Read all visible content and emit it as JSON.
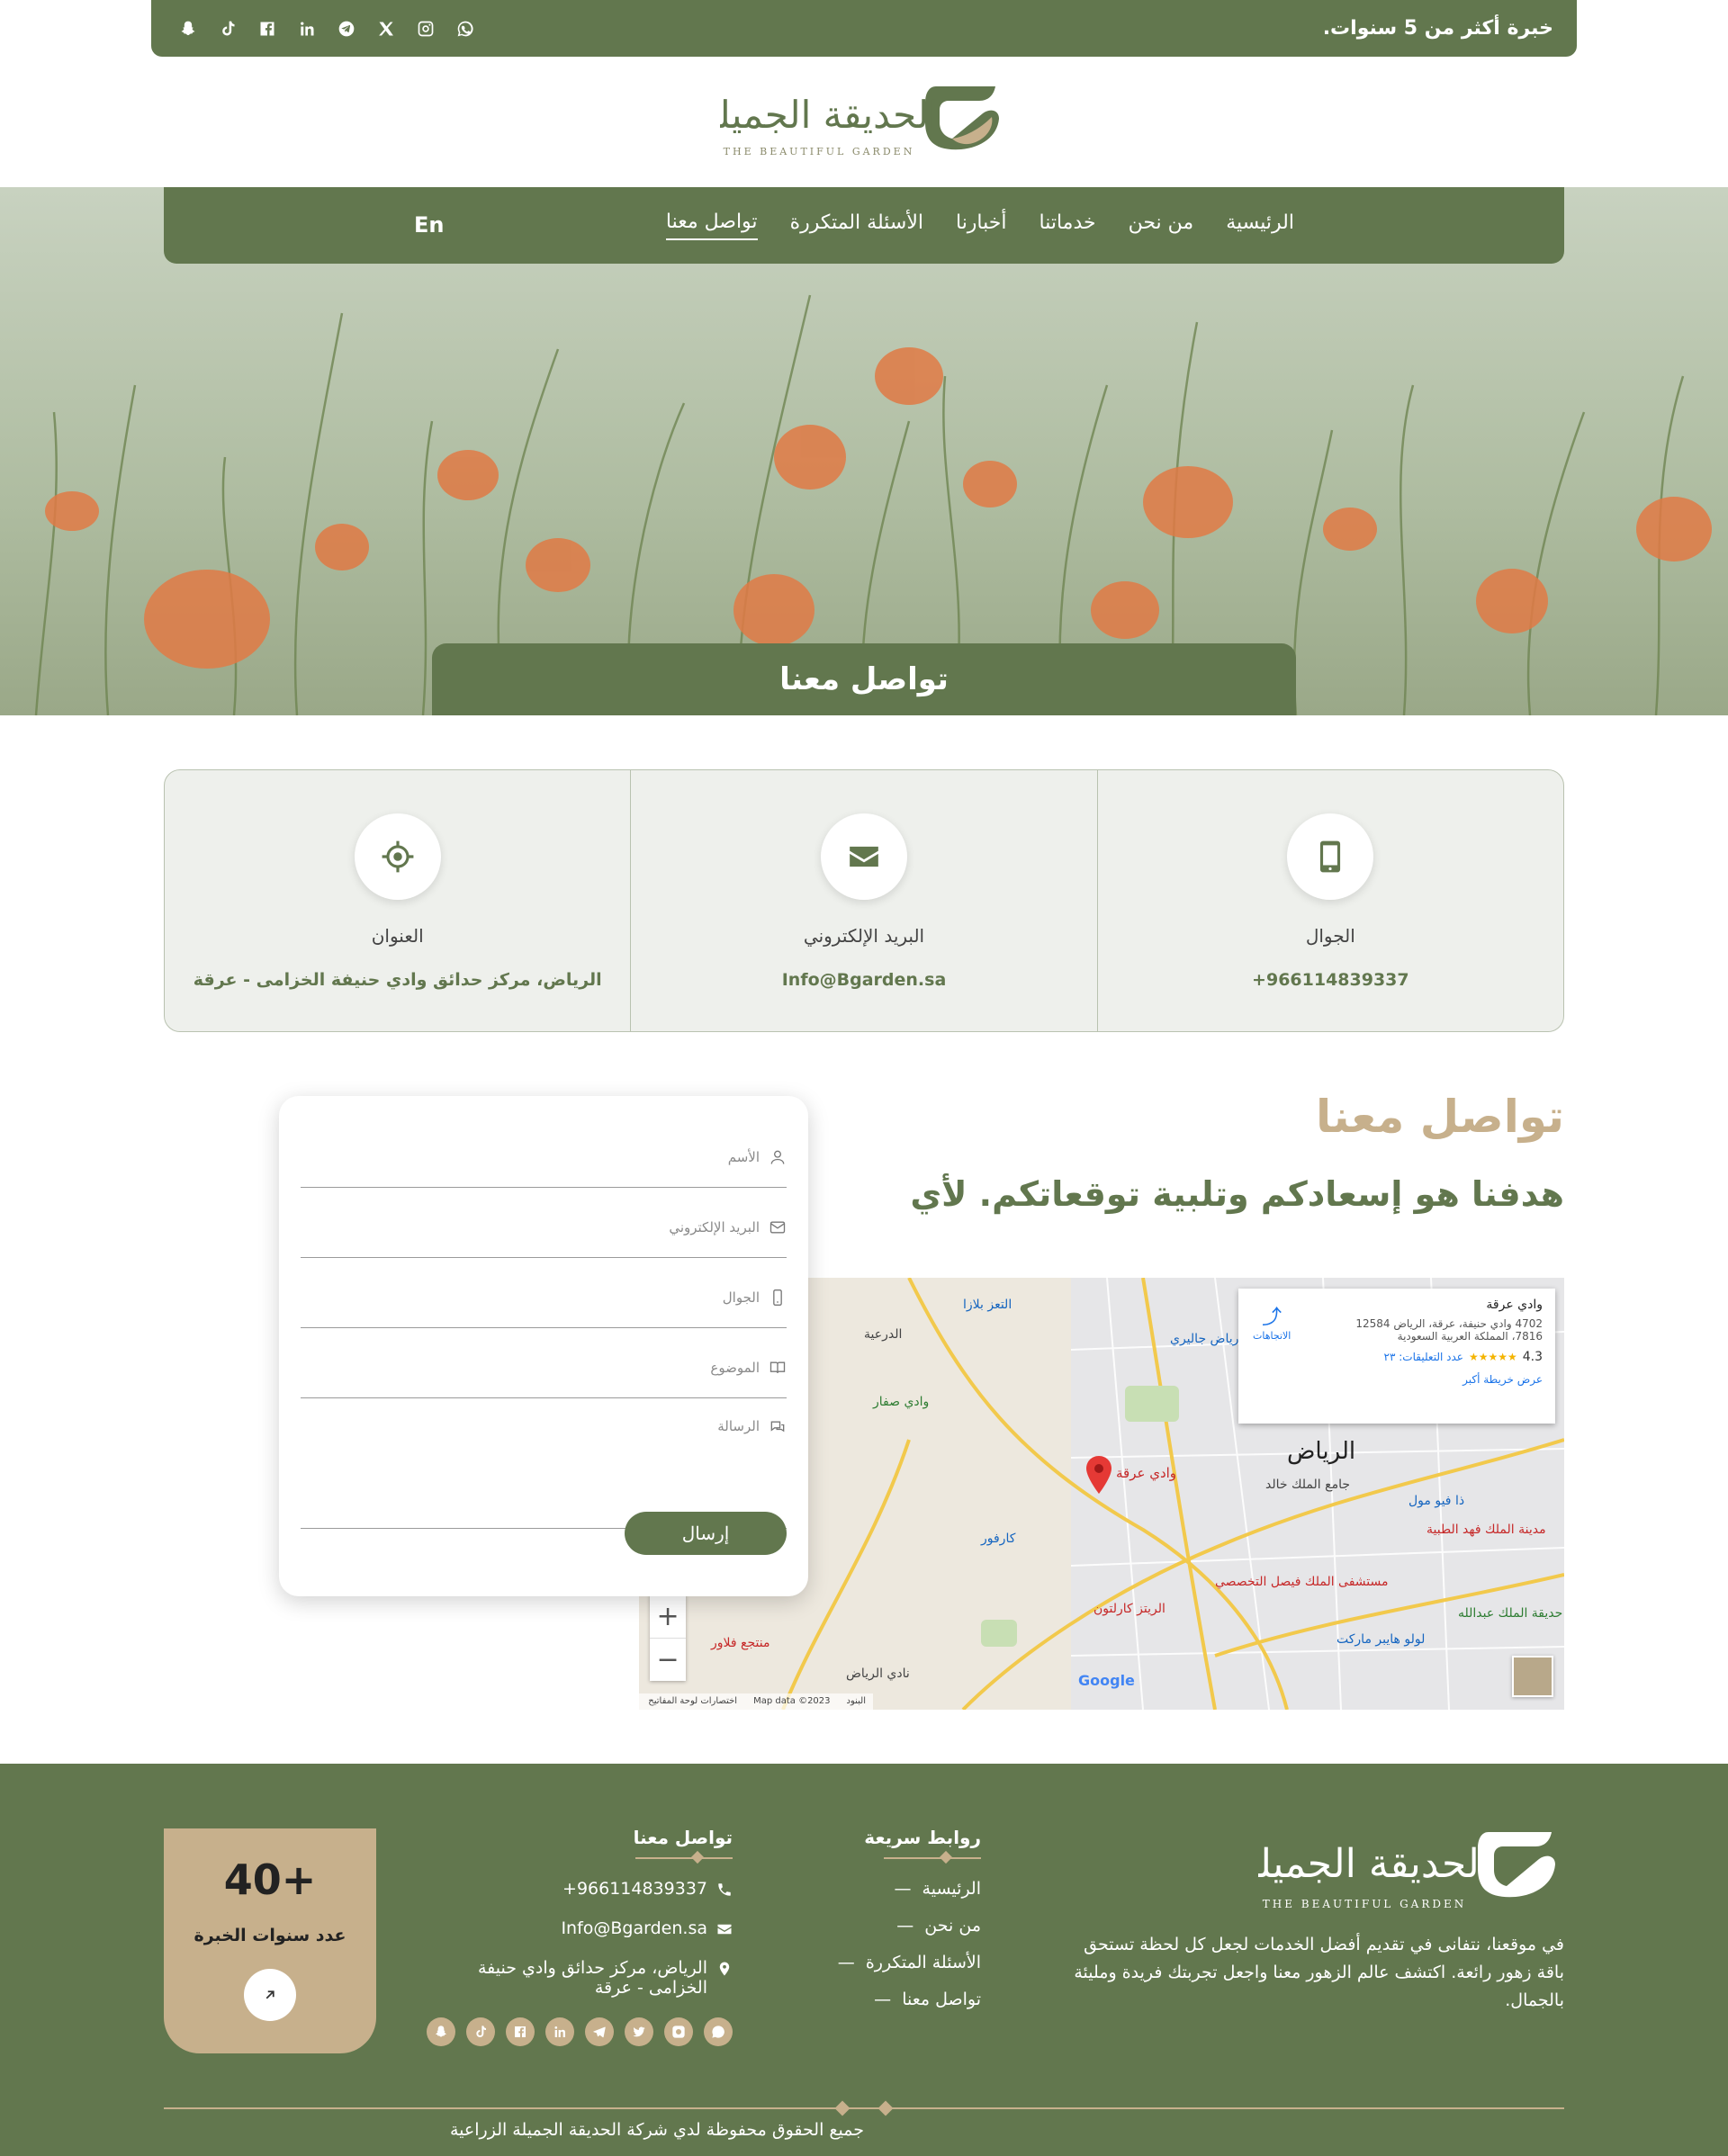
{
  "topbar": {
    "experience": "خبرة أكثر من 5 سنوات.",
    "socials": [
      "snapchat-icon",
      "tiktok-icon",
      "facebook-icon",
      "linkedin-icon",
      "telegram-icon",
      "x-icon",
      "instagram-icon",
      "whatsapp-icon"
    ]
  },
  "logo": {
    "ar": "الحديقة الجميلة",
    "en": "THE BEAUTIFUL GARDEN"
  },
  "nav": {
    "items": [
      {
        "label": "الرئيسية"
      },
      {
        "label": "من نحن"
      },
      {
        "label": "خدماتنا"
      },
      {
        "label": "أخبارنا"
      },
      {
        "label": "الأسئلة المتكررة"
      },
      {
        "label": "تواصل معنا",
        "active": true
      }
    ],
    "lang": "En"
  },
  "hero": {
    "title": "تواصل معنا"
  },
  "info_cards": [
    {
      "icon": "mobile-icon",
      "title": "الجوال",
      "value": "966114839337+"
    },
    {
      "icon": "envelope-icon",
      "title": "البريد الإلكتروني",
      "value": "Info@Bgarden.sa"
    },
    {
      "icon": "location-crosshair-icon",
      "title": "العنوان",
      "value": "الرياض، مركز حدائق وادي حنيفة الخزامى - عرقة"
    }
  ],
  "contact": {
    "title": "تواصل معنا",
    "subtitle": "هدفنا هو إسعادكم وتلبية توقعاتكم. لأي"
  },
  "form": {
    "name_placeholder": "الأسم",
    "email_placeholder": "البريد الإلكتروني",
    "phone_placeholder": "الجوال",
    "subject_placeholder": "الموضوع",
    "message_placeholder": "الرسالة",
    "submit": "إرسال"
  },
  "map": {
    "place_name": "وادي عرقة",
    "address_line1": "4702 وادي حنيفة، عرقة، الرياض 12584",
    "address_line2": "7816، المملكة العربية السعودية",
    "rating": "4.3",
    "reviews": "عدد التعليقات: ٢٣",
    "larger_map": "عرض خريطة أكبر",
    "directions": "الاتجاهات",
    "city_label": "الرياض",
    "marker_label": "وادي عرقة",
    "labels": [
      "الدرعية",
      "وادي صفار",
      "كارفور",
      "التعز بلازا",
      "رياض جاليري",
      "جامع الملك خالد",
      "مستشفى الملك فيصل التخصصي",
      "الريتز كارلتون",
      "منتجع فلاور",
      "نادي الرياض",
      "لولو هايبر ماركت",
      "ذا فيو مول",
      "مدينة الملك فهد الطبية",
      "حديقة الملك عبدالله"
    ],
    "attribution": "Map data ©2023",
    "shortcuts": "اختصارات لوحة المفاتيح",
    "terms": "البنود",
    "google": "Google",
    "zoom_in": "+",
    "zoom_out": "−"
  },
  "footer": {
    "about": "في موقعنا، نتفانى في تقديم أفضل الخدمات لجعل كل لحظة تستحق باقة زهور رائعة. اكتشف عالم الزهور معنا واجعل تجربتك فريدة ومليئة بالجمال.",
    "quick_links_title": "روابط سريعة",
    "quick_links": [
      "الرئيسية",
      "من نحن",
      "الأسئلة المتكررة",
      "تواصل معنا"
    ],
    "contact_title": "تواصل معنا",
    "phone": "966114839337+",
    "email": "Info@Bgarden.sa",
    "address": "الرياض، مركز حدائق وادي حنيفة الخزامى - عرقة",
    "badge_number": "+40",
    "badge_label": "عدد سنوات الخبرة",
    "copyright": "جميع الحقوق محفوظة لدي شركة الحديقة الجميلة الزراعية"
  },
  "colors": {
    "green": "#62774e",
    "tan": "#c7b08c"
  }
}
